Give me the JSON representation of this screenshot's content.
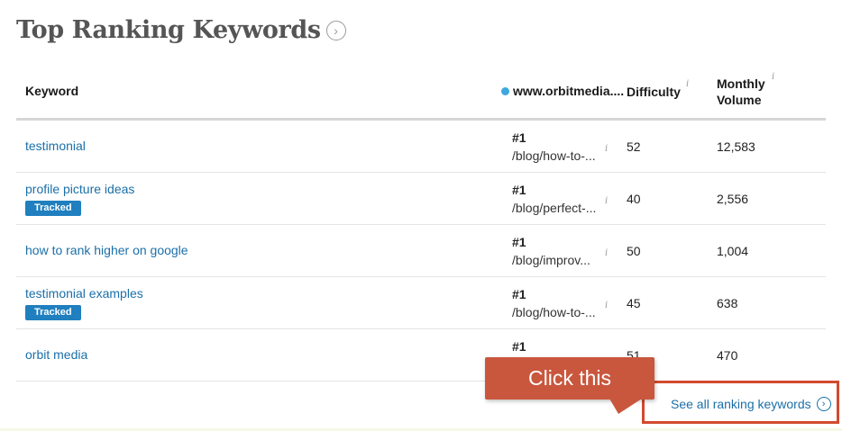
{
  "section": {
    "title": "Top Ranking Keywords",
    "title_icon": "chevron-right-circle-icon"
  },
  "table": {
    "headers": {
      "keyword": "Keyword",
      "site": "www.orbitmedia....",
      "difficulty": "Difficulty",
      "volume_line1": "Monthly",
      "volume_line2": "Volume",
      "info": "i"
    },
    "rows": [
      {
        "keyword": "testimonial",
        "tracked": "",
        "rank": "#1",
        "url": "/blog/how-to-...",
        "info": "i",
        "difficulty": "52",
        "volume": "12,583"
      },
      {
        "keyword": "profile picture ideas",
        "tracked": "Tracked",
        "rank": "#1",
        "url": "/blog/perfect-...",
        "info": "i",
        "difficulty": "40",
        "volume": "2,556"
      },
      {
        "keyword": "how to rank higher on google",
        "tracked": "",
        "rank": "#1",
        "url": "/blog/improv...",
        "info": "i",
        "difficulty": "50",
        "volume": "1,004"
      },
      {
        "keyword": "testimonial examples",
        "tracked": "Tracked",
        "rank": "#1",
        "url": "/blog/how-to-...",
        "info": "i",
        "difficulty": "45",
        "volume": "638"
      },
      {
        "keyword": "orbit media",
        "tracked": "",
        "rank": "#1",
        "url": "",
        "info": "",
        "difficulty": "51",
        "volume": "470"
      }
    ]
  },
  "annotation": {
    "callout_text": "Click this"
  },
  "footer": {
    "see_all_label": "See all ranking keywords",
    "see_all_icon": "chevron-right-circle-icon"
  },
  "colors": {
    "link": "#1b6fa8",
    "badge": "#1f7fbf",
    "callout": "#c9573d",
    "highlight_box": "#d24a2e",
    "site_dot": "#3ea7e0"
  }
}
